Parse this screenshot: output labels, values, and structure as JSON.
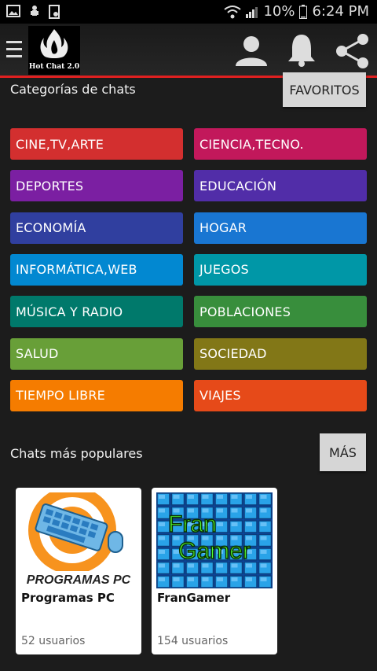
{
  "status_bar": {
    "battery": "10%",
    "time": "6:24 PM"
  },
  "app": {
    "logo_text": "Hot Chat 2.0"
  },
  "categories_section": {
    "title": "Categorías de chats",
    "favorites_button": "FAVORITOS",
    "items": [
      {
        "label": "CINE,TV,ARTE",
        "color": "#d32f2f"
      },
      {
        "label": "CIENCIA,TECNO.",
        "color": "#c2185b"
      },
      {
        "label": "DEPORTES",
        "color": "#7b1fa2"
      },
      {
        "label": "EDUCACIÓN",
        "color": "#512da8"
      },
      {
        "label": "ECONOMÍA",
        "color": "#303f9f"
      },
      {
        "label": "HOGAR",
        "color": "#1976d2"
      },
      {
        "label": "INFORMÁTICA,WEB",
        "color": "#0288d1"
      },
      {
        "label": "JUEGOS",
        "color": "#0097a7"
      },
      {
        "label": "MÚSICA Y RADIO",
        "color": "#00796b"
      },
      {
        "label": "POBLACIONES",
        "color": "#388e3c"
      },
      {
        "label": "SALUD",
        "color": "#689f38"
      },
      {
        "label": "SOCIEDAD",
        "color": "#827717"
      },
      {
        "label": "TIEMPO LIBRE",
        "color": "#f57c00"
      },
      {
        "label": "VIAJES",
        "color": "#e64a19"
      }
    ]
  },
  "popular_section": {
    "title": "Chats más populares",
    "more_button": "MÁS",
    "chats": [
      {
        "title": "Programas PC",
        "users": "52 usuarios",
        "image_caption": "PROGRAMAS PC"
      },
      {
        "title": "FranGamer",
        "users": "154 usuarios",
        "image_caption_line1": "Fran",
        "image_caption_line2": "Gamer"
      }
    ]
  }
}
